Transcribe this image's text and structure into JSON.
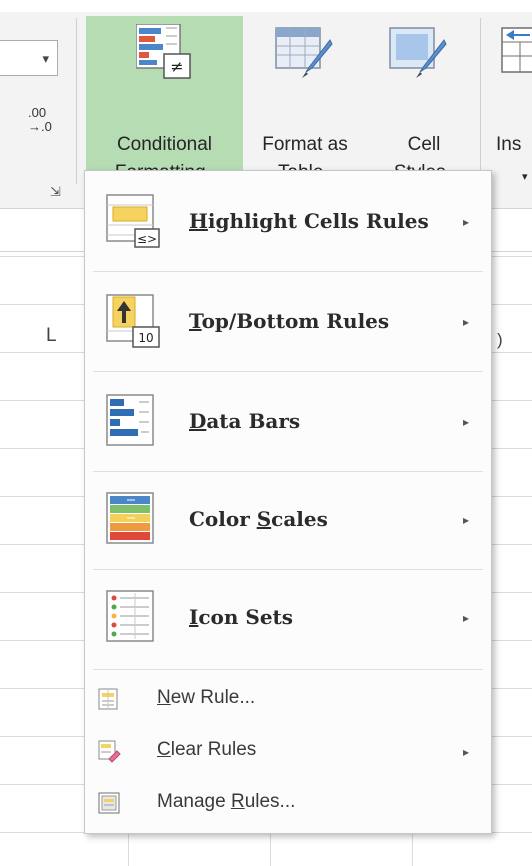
{
  "ribbon": {
    "decimal_icon": ".00\n→.0",
    "dropdown_arrow": "▾",
    "group_launcher": "⇲",
    "conditional_formatting": {
      "line1": "Conditional",
      "line2": "Formatting",
      "icon": "conditional-formatting-icon",
      "active": true
    },
    "format_as_table": {
      "line1": "Format as",
      "line2": "Table",
      "icon": "format-as-table-icon"
    },
    "cell_styles": {
      "line1": "Cell",
      "line2": "Styles",
      "icon": "cell-styles-icon"
    },
    "insert": {
      "line1": "Ins",
      "icon": "insert-cells-icon"
    },
    "accent_active": "#b5dcb3"
  },
  "grid": {
    "column_label": "L",
    "column_label_edge": ")"
  },
  "menu": {
    "items": [
      {
        "pre": "",
        "key": "H",
        "post": "ighlight Cells Rules",
        "icon": "highlight-cells-rules-icon",
        "has_submenu": true
      },
      {
        "pre": "",
        "key": "T",
        "post": "op/Bottom Rules",
        "icon": "top-bottom-rules-icon",
        "has_submenu": true
      },
      {
        "pre": "",
        "key": "D",
        "post": "ata Bars",
        "icon": "data-bars-icon",
        "has_submenu": true
      },
      {
        "pre": "Color ",
        "key": "S",
        "post": "cales",
        "icon": "color-scales-icon",
        "has_submenu": true
      },
      {
        "pre": "",
        "key": "I",
        "post": "con Sets",
        "icon": "icon-sets-icon",
        "has_submenu": true
      },
      {
        "pre": "",
        "key": "N",
        "post": "ew Rule...",
        "icon": "new-rule-icon",
        "has_submenu": false
      },
      {
        "pre": "",
        "key": "C",
        "post": "lear Rules",
        "icon": "clear-rules-icon",
        "has_submenu": true
      },
      {
        "pre": "Manage ",
        "key": "R",
        "post": "ules...",
        "icon": "manage-rules-icon",
        "has_submenu": false
      }
    ],
    "submenu_arrow": "▸",
    "top_bottom_badge": "10"
  }
}
